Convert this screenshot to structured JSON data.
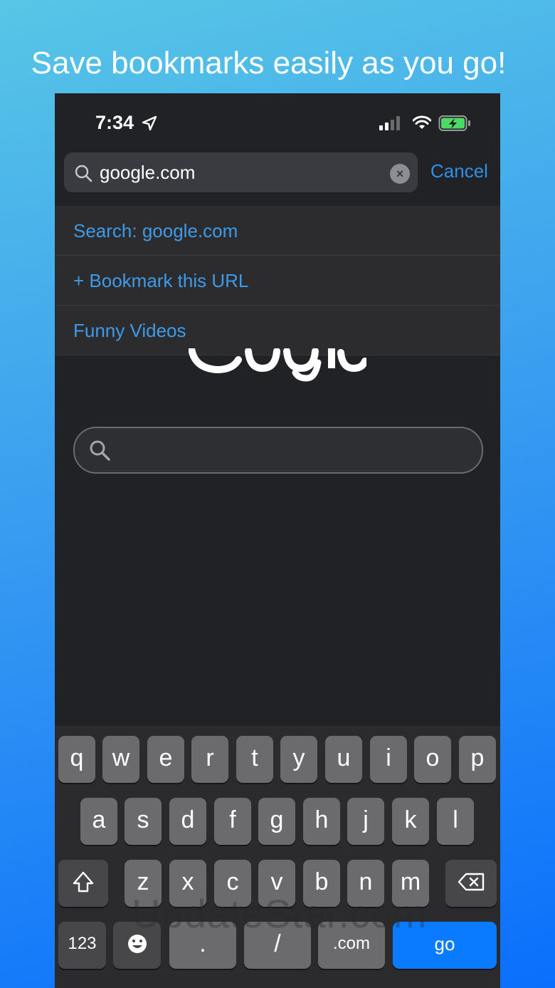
{
  "headline": "Save bookmarks easily as you go!",
  "status": {
    "time": "7:34"
  },
  "search": {
    "value": "google.com",
    "cancel_label": "Cancel",
    "clear_label": "×"
  },
  "suggestions": [
    {
      "label": "Search: google.com"
    },
    {
      "label": "+ Bookmark this URL"
    },
    {
      "label": "Funny Videos"
    }
  ],
  "keyboard": {
    "row1": [
      "q",
      "w",
      "e",
      "r",
      "t",
      "y",
      "u",
      "i",
      "o",
      "p"
    ],
    "row2": [
      "a",
      "s",
      "d",
      "f",
      "g",
      "h",
      "j",
      "k",
      "l"
    ],
    "row3": [
      "z",
      "x",
      "c",
      "v",
      "b",
      "n",
      "m"
    ],
    "numbers_label": "123",
    "dot_label": ".",
    "slash_label": "/",
    "dotcom_label": ".com",
    "go_label": "go"
  },
  "watermark": "UpdateStar.com",
  "colors": {
    "accent": "#2f90e8",
    "link": "#3d9be9",
    "go_key": "#0a7bff",
    "battery": "#4cd964"
  }
}
